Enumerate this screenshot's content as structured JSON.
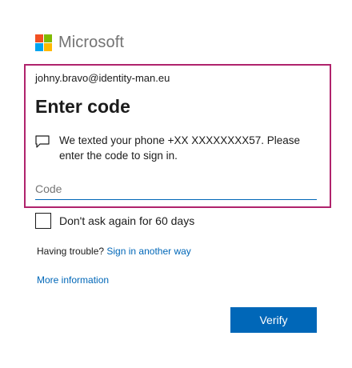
{
  "brand": {
    "name": "Microsoft",
    "logo_icon": "microsoft-logo",
    "logo_colors": [
      "#f25022",
      "#7fba00",
      "#00a4ef",
      "#ffb900"
    ]
  },
  "signin": {
    "identity": "johny.bravo@identity-man.eu",
    "title": "Enter code",
    "message_icon": "chat-bubble-icon",
    "message": "We texted your phone +XX XXXXXXXX57. Please enter the code to sign in.",
    "code_placeholder": "Code",
    "code_value": ""
  },
  "options": {
    "remember_label": "Don't ask again for 60 days",
    "remember_checked": false,
    "trouble_prefix": "Having trouble?",
    "trouble_link": "Sign in another way",
    "more_info_link": "More information"
  },
  "actions": {
    "verify_label": "Verify"
  },
  "colors": {
    "accent": "#0067b8",
    "highlight_border": "#b0236c",
    "brand_text": "#737373"
  }
}
